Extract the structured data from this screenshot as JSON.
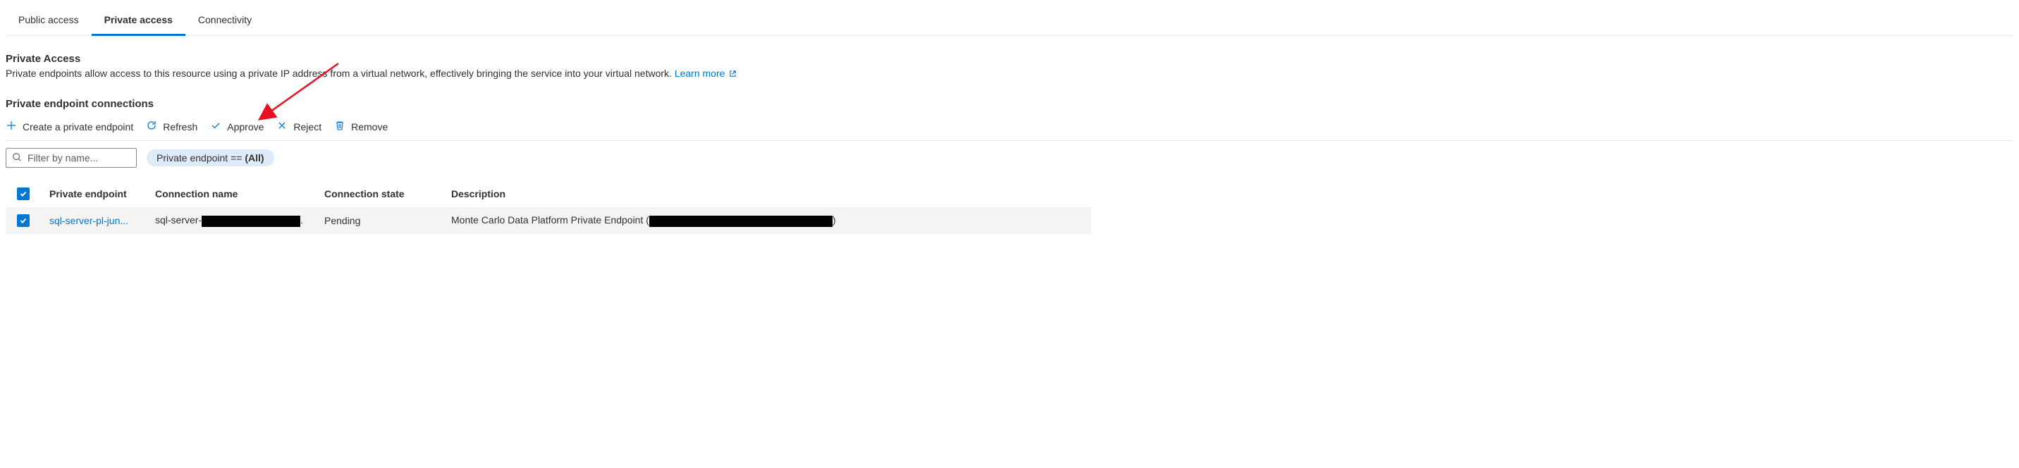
{
  "tabs": [
    {
      "label": "Public access",
      "active": false
    },
    {
      "label": "Private access",
      "active": true
    },
    {
      "label": "Connectivity",
      "active": false
    }
  ],
  "privateAccess": {
    "title": "Private Access",
    "description": "Private endpoints allow access to this resource using a private IP address from a virtual network, effectively bringing the service into your virtual network. ",
    "learnMore": "Learn more"
  },
  "endpointSection": {
    "title": "Private endpoint connections"
  },
  "toolbar": {
    "create": "Create a private endpoint",
    "refresh": "Refresh",
    "approve": "Approve",
    "reject": "Reject",
    "remove": "Remove"
  },
  "filter": {
    "placeholder": "Filter by name...",
    "pillPrefix": "Private endpoint == ",
    "pillValue": "(All)"
  },
  "table": {
    "headers": {
      "endpoint": "Private endpoint",
      "connName": "Connection name",
      "state": "Connection state",
      "desc": "Description"
    },
    "rows": [
      {
        "endpoint": "sql-server-pl-jun...",
        "connPrefix": "sql-server-",
        "connSuffix": ".",
        "state": "Pending",
        "descPrefix": "Monte Carlo Data Platform Private Endpoint (",
        "descSuffix": ")"
      }
    ]
  }
}
